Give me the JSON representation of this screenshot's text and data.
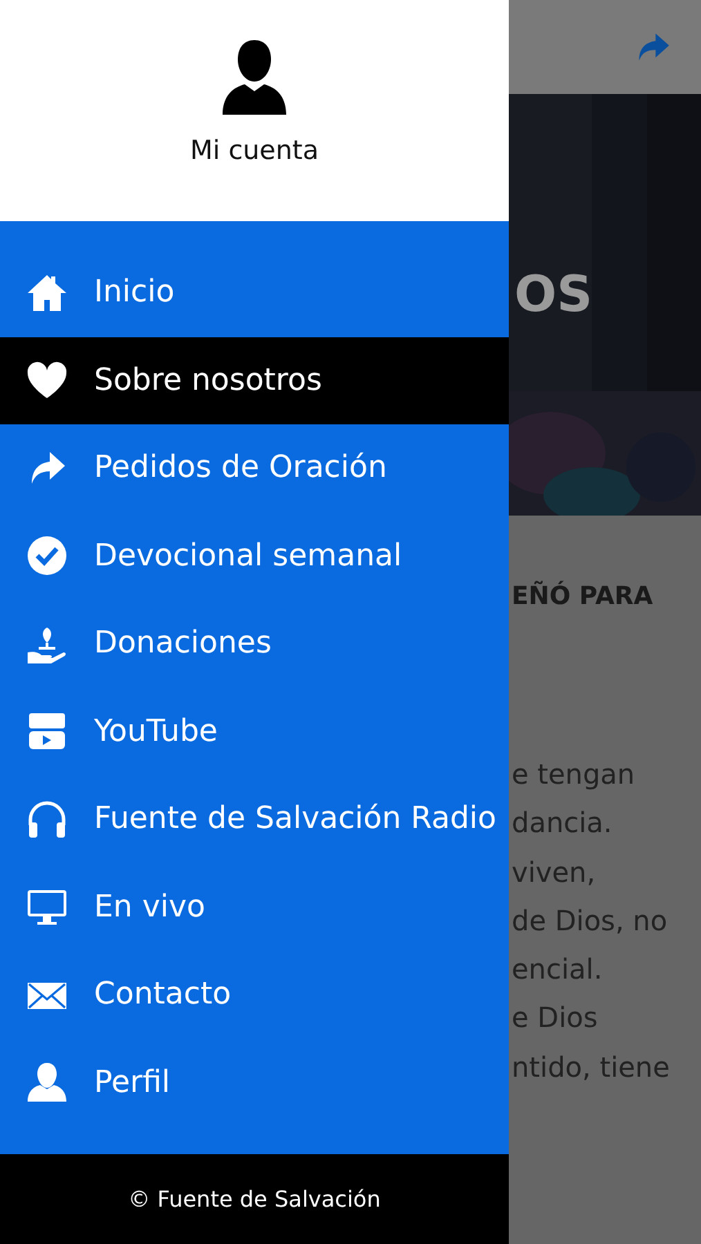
{
  "page": {
    "heading": "OS",
    "subheading": "EÑÓ PARA",
    "lines": [
      "e tengan",
      "dancia.",
      "viven,",
      "de Dios, no",
      "encial.",
      "e Dios",
      "ntido, tiene"
    ]
  },
  "drawer": {
    "account": "Mi cuenta",
    "menu": [
      {
        "label": "Inicio",
        "selected": false
      },
      {
        "label": "Sobre nosotros",
        "selected": true
      },
      {
        "label": "Pedidos de Oración",
        "selected": false
      },
      {
        "label": "Devocional semanal",
        "selected": false
      },
      {
        "label": "Donaciones",
        "selected": false
      },
      {
        "label": "YouTube",
        "selected": false
      },
      {
        "label": "Fuente de Salvación Radio",
        "selected": false
      },
      {
        "label": "En vivo",
        "selected": false
      },
      {
        "label": "Contacto",
        "selected": false
      },
      {
        "label": "Perfil",
        "selected": false
      }
    ],
    "footer": "© Fuente de Salvación"
  }
}
